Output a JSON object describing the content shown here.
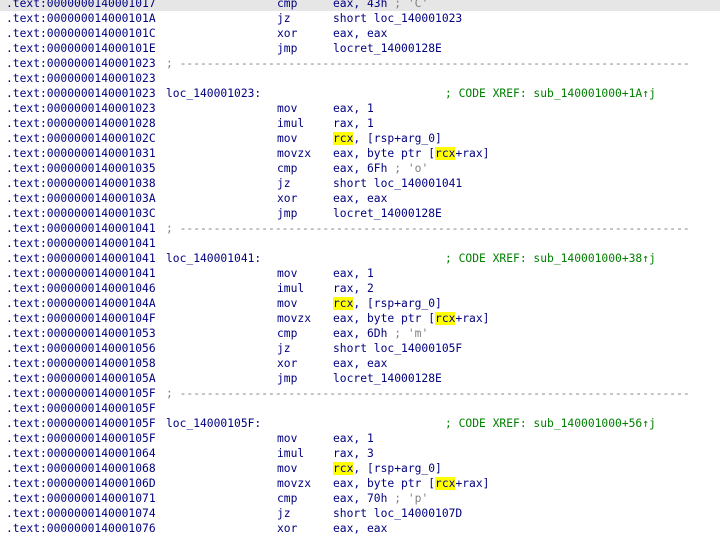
{
  "rows": [
    {
      "addr": ".text:0000000140001017",
      "mnemonic": "cmp",
      "operands": "eax, 43h",
      "comment": "; 'C'",
      "current": true
    },
    {
      "addr": ".text:000000014000101A",
      "mnemonic": "jz",
      "operands": "short loc_140001023"
    },
    {
      "addr": ".text:000000014000101C",
      "mnemonic": "xor",
      "operands": "eax, eax"
    },
    {
      "addr": ".text:000000014000101E",
      "mnemonic": "jmp",
      "operands": "locret_14000128E"
    },
    {
      "addr": ".text:0000000140001023",
      "separator": "; ---------------------------------------------------------------------------"
    },
    {
      "addr": ".text:0000000140001023"
    },
    {
      "addr": ".text:0000000140001023",
      "label": "loc_140001023:",
      "xref": "; CODE XREF: sub_140001000+1A↑j"
    },
    {
      "addr": ".text:0000000140001023",
      "mnemonic": "mov",
      "operands": "eax, 1"
    },
    {
      "addr": ".text:0000000140001028",
      "mnemonic": "imul",
      "operands": "rax, 1"
    },
    {
      "addr": ".text:000000014000102C",
      "mnemonic": "mov",
      "op_pre": "",
      "op_hl": "rcx",
      "op_post": ", [rsp+arg_0]"
    },
    {
      "addr": ".text:0000000140001031",
      "mnemonic": "movzx",
      "op_pre": "eax, byte ptr [",
      "op_hl": "rcx",
      "op_post": "+rax]"
    },
    {
      "addr": ".text:0000000140001035",
      "mnemonic": "cmp",
      "operands": "eax, 6Fh",
      "comment": "; 'o'"
    },
    {
      "addr": ".text:0000000140001038",
      "mnemonic": "jz",
      "operands": "short loc_140001041"
    },
    {
      "addr": ".text:000000014000103A",
      "mnemonic": "xor",
      "operands": "eax, eax"
    },
    {
      "addr": ".text:000000014000103C",
      "mnemonic": "jmp",
      "operands": "locret_14000128E"
    },
    {
      "addr": ".text:0000000140001041",
      "separator": "; ---------------------------------------------------------------------------"
    },
    {
      "addr": ".text:0000000140001041"
    },
    {
      "addr": ".text:0000000140001041",
      "label": "loc_140001041:",
      "xref": "; CODE XREF: sub_140001000+38↑j"
    },
    {
      "addr": ".text:0000000140001041",
      "mnemonic": "mov",
      "operands": "eax, 1"
    },
    {
      "addr": ".text:0000000140001046",
      "mnemonic": "imul",
      "operands": "rax, 2"
    },
    {
      "addr": ".text:000000014000104A",
      "mnemonic": "mov",
      "op_pre": "",
      "op_hl": "rcx",
      "op_post": ", [rsp+arg_0]"
    },
    {
      "addr": ".text:000000014000104F",
      "mnemonic": "movzx",
      "op_pre": "eax, byte ptr [",
      "op_hl": "rcx",
      "op_post": "+rax]"
    },
    {
      "addr": ".text:0000000140001053",
      "mnemonic": "cmp",
      "operands": "eax, 6Dh",
      "comment": "; 'm'"
    },
    {
      "addr": ".text:0000000140001056",
      "mnemonic": "jz",
      "operands": "short loc_14000105F"
    },
    {
      "addr": ".text:0000000140001058",
      "mnemonic": "xor",
      "operands": "eax, eax"
    },
    {
      "addr": ".text:000000014000105A",
      "mnemonic": "jmp",
      "operands": "locret_14000128E"
    },
    {
      "addr": ".text:000000014000105F",
      "separator": "; ---------------------------------------------------------------------------"
    },
    {
      "addr": ".text:000000014000105F"
    },
    {
      "addr": ".text:000000014000105F",
      "label": "loc_14000105F:",
      "xref": "; CODE XREF: sub_140001000+56↑j"
    },
    {
      "addr": ".text:000000014000105F",
      "mnemonic": "mov",
      "operands": "eax, 1"
    },
    {
      "addr": ".text:0000000140001064",
      "mnemonic": "imul",
      "operands": "rax, 3"
    },
    {
      "addr": ".text:0000000140001068",
      "mnemonic": "mov",
      "op_pre": "",
      "op_hl": "rcx",
      "op_post": ", [rsp+arg_0]"
    },
    {
      "addr": ".text:000000014000106D",
      "mnemonic": "movzx",
      "op_pre": "eax, byte ptr [",
      "op_hl": "rcx",
      "op_post": "+rax]"
    },
    {
      "addr": ".text:0000000140001071",
      "mnemonic": "cmp",
      "operands": "eax, 70h",
      "comment": "; 'p'"
    },
    {
      "addr": ".text:0000000140001074",
      "mnemonic": "jz",
      "operands": "short loc_14000107D"
    },
    {
      "addr": ".text:0000000140001076",
      "mnemonic": "xor",
      "operands": "eax, eax"
    }
  ],
  "colors": {
    "text": "#000080",
    "comment": "#808080",
    "xref": "#008000",
    "highlight": "#ffff00",
    "current_line": "#e6e6e6"
  }
}
